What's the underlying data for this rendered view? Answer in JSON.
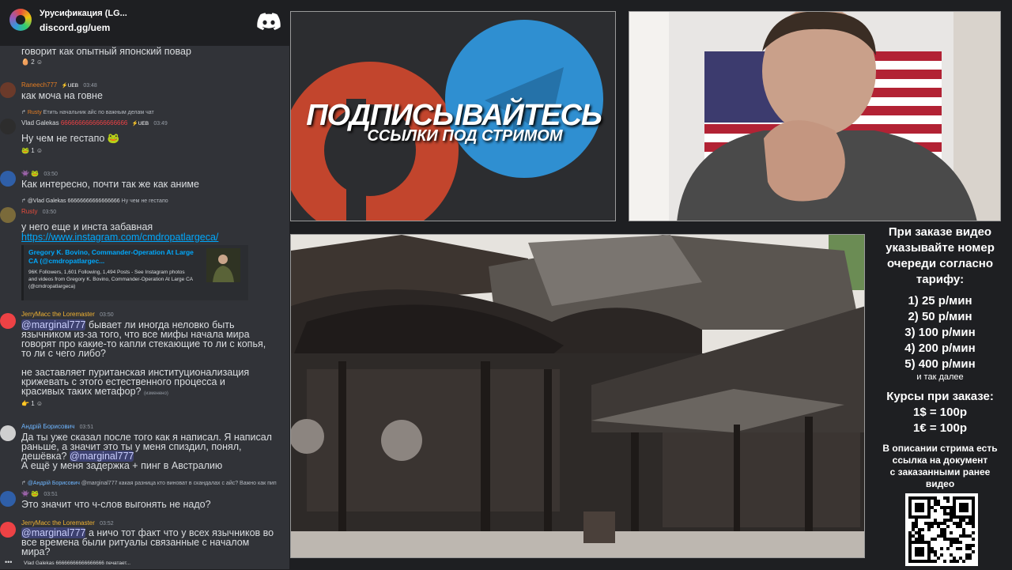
{
  "chat": {
    "server_name": "Урусификация (LG...",
    "server_invite": "discord.gg/uem",
    "messages": [
      {
        "text": "говорит как опытный японский повар",
        "reaction": "2"
      },
      {
        "author": "Raneech777",
        "badges": "⚡UEB",
        "time": "03:48",
        "text": "как моча на говне"
      },
      {
        "reply_author": "Rusty",
        "reply_text": "Етить начальник айс по важным делам чат",
        "author": "Vlad Galekas",
        "author_tag": "6666666666666666666",
        "badges": "⚡UEB",
        "time": "03:49",
        "text": "Ну чем не гестапо",
        "reaction": "1"
      },
      {
        "time": "03:50",
        "text": "Как интересно, почти так же как аниме"
      },
      {
        "reply_author": "@Vlad Galekas 66666666666666666",
        "reply_text": "Ну чем не гестапо",
        "author": "Rusty",
        "time": "03:50",
        "text": "у него еще и инста забавная",
        "link": "https://www.instagram.com/cmdropatlargeca/",
        "embed": {
          "title": "Gregory K. Bovino, Commander-Operation At Large CA (@cmdropatlargec...",
          "description": "96K Followers, 1,601 Following, 1,494 Posts - See Instagram photos and videos from Gregory K. Bovino, Commander-Operation At Large CA (@cmdropatlargeca)"
        }
      },
      {
        "author": "JerryMacc the Loremaster",
        "time": "03:50",
        "mention": "@marginal777",
        "text1": " бывает ли иногда неловко быть",
        "text2": "язычником из-за того, что все мифы начала мира",
        "text3": "говорят про какие-то капли стекающие то ли с копья,",
        "text4": "то ли с чего либо?",
        "text5": "не заставляет пуританская институционализация",
        "text6": "крижевать с этого естественного процесса и",
        "text7": "красивых таких метафор?",
        "edited": "(изменено)",
        "reaction": "1"
      },
      {
        "author": "Андрій Борисович",
        "time": "03:51",
        "text1": "Да ты уже сказал после того как я написал. Я написал",
        "text2": "раньше, а значит это ты у меня спиздил, понял,",
        "text3": "дешёвка?",
        "mention": "@marginal777",
        "text4": "А ещё у меня задержка + пинг в Австралию"
      },
      {
        "reply_author": "@Андрій Борисович",
        "reply_text": "@marginal777 какая разница кто виноват в скандалах с айс? Важно как пип",
        "time": "03:51",
        "text": "Это значит что ч-слов выгонять не надо?"
      },
      {
        "author": "JerryMacc the Loremaster",
        "time": "03:52",
        "mention": "@marginal777",
        "text1": " а ничо тот факт что у всех язычников во",
        "text2": "все времена были ритуалы связанные с началом",
        "text3": "мира?"
      }
    ],
    "typing": "Vlad Galekas 66666666666666666 печатает..."
  },
  "banner": {
    "heading": "ПОДПИСЫВАЙТЕСЬ",
    "subheading": "ССЫЛКИ ПОД СТРИМОМ"
  },
  "info": {
    "order_note": [
      "При заказе видео",
      "указывайте номер",
      "очереди согласно",
      "тарифу:"
    ],
    "tariffs": [
      "1) 25 р/мин",
      "2) 50 р/мин",
      "3) 100 р/мин",
      "4) 200 р/мин",
      "5) 400 р/мин"
    ],
    "etc": "и так далее",
    "rates_title": "Курсы при заказе:",
    "rates": [
      "1$ = 100р",
      "1€ = 100р"
    ],
    "doc_note": [
      "В описании стрима есть",
      "ссылка на документ",
      "с заказанными ранее",
      "видео"
    ]
  },
  "colors": {
    "chat_bg": "#313338",
    "mention_fg": "#c9cdfb",
    "link": "#00a8fc",
    "patreon": "#c2452d",
    "telegram": "#2f8fd1"
  }
}
